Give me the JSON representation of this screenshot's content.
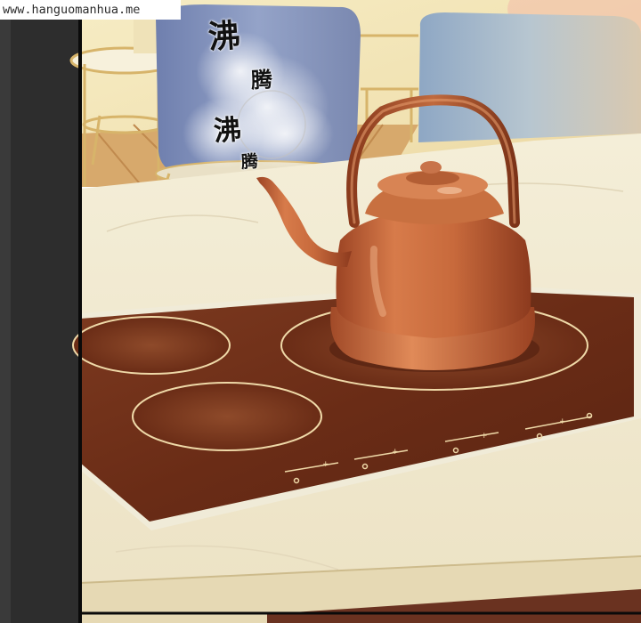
{
  "watermark": "www.hanguomanhua.me",
  "sound_effects": [
    "沸",
    "腾",
    "沸",
    "腾"
  ],
  "colors": {
    "left_bar": "#2d2d2d",
    "panel_border": "#0a0a0a",
    "counter": "#f2ead2",
    "cooktop": "#6e2e18",
    "burner_ring": "#efd9a8",
    "kettle": "#c06438",
    "chair_blue": "#7f8fb8",
    "wall": "#f3e6b8"
  }
}
